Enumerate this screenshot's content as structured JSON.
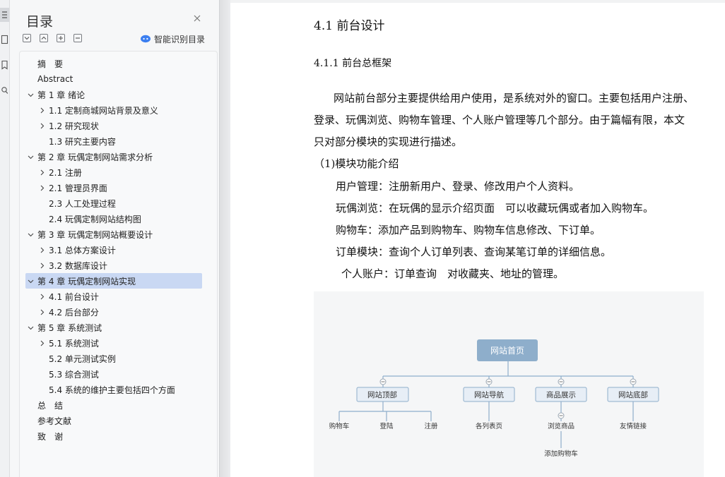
{
  "outline": {
    "title": "目录",
    "smart_label": "智能识别目录",
    "items": [
      {
        "label": "摘　要"
      },
      {
        "label": "Abstract"
      },
      {
        "label": "第 1 章  绪论"
      },
      {
        "label": "1.1  定制商城网站背景及意义"
      },
      {
        "label": "1.2 研究现状"
      },
      {
        "label": "1.3  研究主要内容"
      },
      {
        "label": "第 2 章  玩偶定制网站需求分析"
      },
      {
        "label": "2.1 注册"
      },
      {
        "label": "2.1 管理员界面"
      },
      {
        "label": "2.3 人工处理过程"
      },
      {
        "label": "2.4 玩偶定制网站结构图"
      },
      {
        "label": "第 3 章  玩偶定制网站概要设计"
      },
      {
        "label": "3.1 总体方案设计"
      },
      {
        "label": "3.2  数据库设计"
      },
      {
        "label": "第 4 章  玩偶定制网站实现"
      },
      {
        "label": "4.1  前台设计"
      },
      {
        "label": "4.2  后台部分"
      },
      {
        "label": "第 5 章  系统测试"
      },
      {
        "label": "5.1 系统测试"
      },
      {
        "label": "5.2 单元测试实例"
      },
      {
        "label": "5.3 综合测试"
      },
      {
        "label": "5.4 系统的维护主要包括四个方面"
      },
      {
        "label": "总　结"
      },
      {
        "label": "参考文献"
      },
      {
        "label": "致　谢"
      }
    ]
  },
  "document": {
    "section_heading": "4.1  前台设计",
    "subsection_heading": "4.1.1  前台总框架",
    "paragraphs": [
      "网站前台部分主要提供给用户使用，是系统对外的窗口。主要包括用户注册、",
      "登录、玩偶浏览、购物车管理、个人账户管理等几个部分。由于篇幅有限，本文",
      "只对部分模块的实现进行描述。",
      "（1)模块功能介绍",
      "用户管理：注册新用户、登录、修改用户个人资料。",
      "玩偶浏览：在玩偶的显示介绍页面　可以收藏玩偶或者加入购物车。",
      "购物车：添加产品到购物车、购物车信息修改、下订单。",
      "订单模块：查询个人订单列表、查询某笔订单的详细信息。",
      "个人账户：订单查询　对收藏夹、地址的管理。"
    ],
    "diagram": {
      "root": "网站首页",
      "branches": [
        "网站顶部",
        "网站导航",
        "商品展示",
        "网站底部"
      ],
      "leaves": [
        "购物车",
        "登陆",
        "注册",
        "各列表页",
        "浏览商品",
        "友情链接",
        "添加购物车"
      ]
    }
  },
  "colors": {
    "accent": "#c9d8f3",
    "root_node": "#8eaecb",
    "branch_fill": "#e7eef6",
    "branch_border": "#8eaecb"
  }
}
